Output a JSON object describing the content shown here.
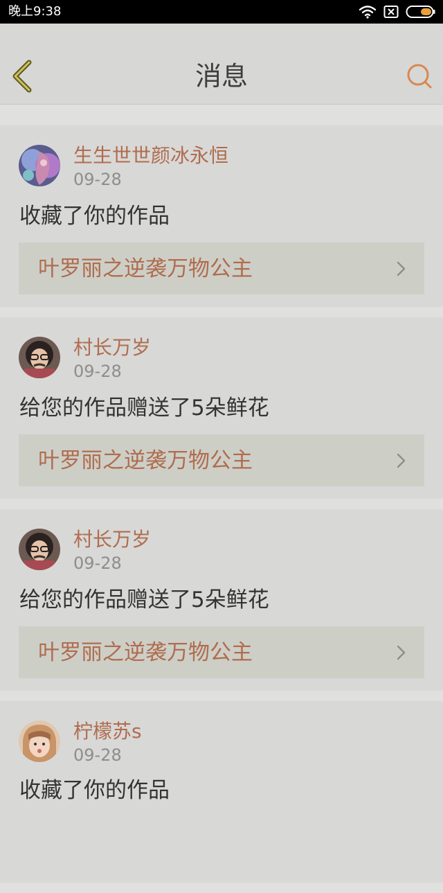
{
  "status_bar": {
    "time": "晚上9:38",
    "icons": [
      "wifi-icon",
      "no-sim-icon",
      "battery-icon"
    ]
  },
  "header": {
    "title": "消息",
    "back_icon": "chevron-left-icon",
    "search_icon": "search-icon"
  },
  "colors": {
    "accent": "#b06c4e",
    "nav_accent": "#d8884f",
    "card_bg": "#d8d8d7",
    "link_bg": "#cdcfc7"
  },
  "messages": [
    {
      "user": "生生世世颜冰永恒",
      "date": "09-28",
      "text": "收藏了你的作品",
      "work": "叶罗丽之逆袭万物公主"
    },
    {
      "user": "村长万岁",
      "date": "09-28",
      "text": "给您的作品赠送了5朵鲜花",
      "work": "叶罗丽之逆袭万物公主"
    },
    {
      "user": "村长万岁",
      "date": "09-28",
      "text": "给您的作品赠送了5朵鲜花",
      "work": "叶罗丽之逆袭万物公主"
    },
    {
      "user": "柠檬苏s",
      "date": "09-28",
      "text": "收藏了你的作品"
    }
  ]
}
